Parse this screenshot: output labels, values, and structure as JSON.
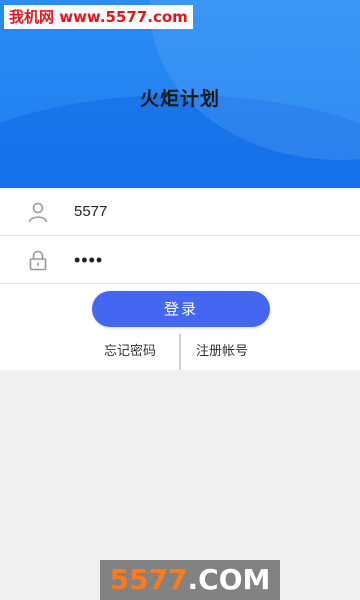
{
  "watermark": {
    "top_text": "我机网 www.5577.com",
    "bottom_number": "5577",
    "bottom_suffix": ".COM"
  },
  "header": {
    "title": "火炬计划",
    "gradient_color": "#1c7cf0"
  },
  "form": {
    "username_value": "5577",
    "password_value": "••••",
    "username_icon": "user-icon",
    "password_icon": "lock-icon"
  },
  "actions": {
    "login_label": "登录",
    "forgot_password_label": "忘记密码",
    "register_label": "注册帐号",
    "login_button_color": "#4566f0"
  }
}
